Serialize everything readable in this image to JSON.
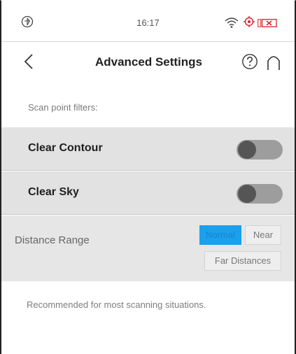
{
  "status_bar": {
    "time": "16:17",
    "logo_icon": "app-logo-icon",
    "wifi_icon": "wifi-icon",
    "gps_icon": "gps-target-icon",
    "battery_icon": "battery-low-icon",
    "battery_color": "#d8222a"
  },
  "header": {
    "title": "Advanced Settings",
    "back_icon": "chevron-left-icon",
    "help_icon": "help-circle-icon",
    "home_icon": "home-icon"
  },
  "filters": {
    "section_label": "Scan point filters:",
    "items": [
      {
        "label": "Clear Contour",
        "enabled": false
      },
      {
        "label": "Clear Sky",
        "enabled": false
      }
    ]
  },
  "distance_range": {
    "label": "Distance Range",
    "options": [
      "Normal",
      "Near",
      "Far Distances"
    ],
    "selected": "Normal",
    "accent_color": "#1aa0ec"
  },
  "note": "Recommended for most scanning situations."
}
